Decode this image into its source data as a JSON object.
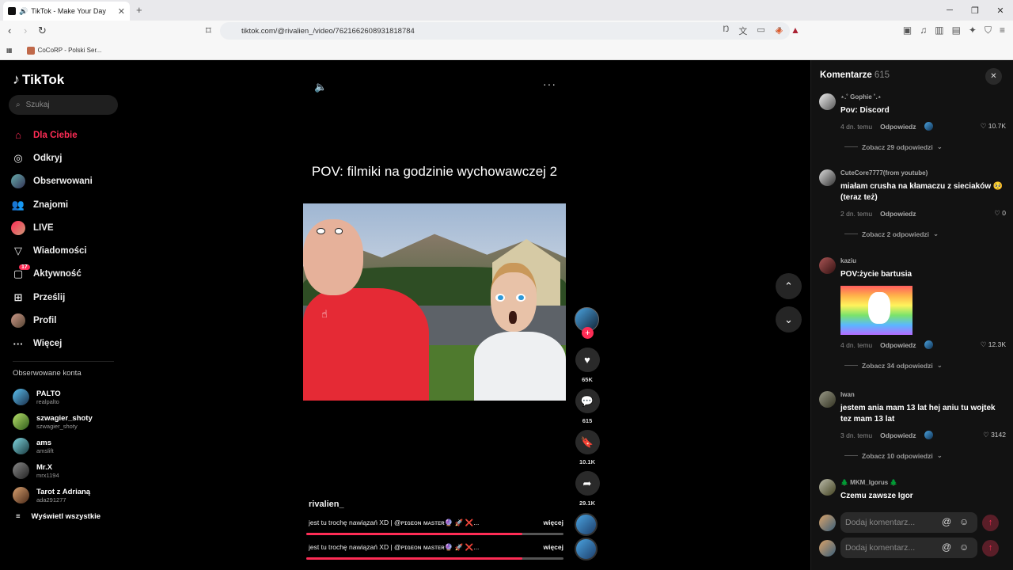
{
  "browser": {
    "tab_title": "TikTok - Make Your Day",
    "url": "tiktok.com/@rivalien_/video/7621662608931818784",
    "bookmark": "CoCoRP - Polski Ser..."
  },
  "sidebar": {
    "logo": "TikTok",
    "search_placeholder": "Szukaj",
    "nav": [
      {
        "label": "Dla Ciebie"
      },
      {
        "label": "Odkryj"
      },
      {
        "label": "Obserwowani"
      },
      {
        "label": "Znajomi"
      },
      {
        "label": "LIVE"
      },
      {
        "label": "Wiadomości"
      },
      {
        "label": "Aktywność",
        "badge": "17"
      },
      {
        "label": "Prześlij"
      },
      {
        "label": "Profil"
      },
      {
        "label": "Więcej"
      }
    ],
    "followed_title": "Obserwowane konta",
    "followed": [
      {
        "name": "PALTO",
        "handle": "realpalto"
      },
      {
        "name": "szwagier_shoty",
        "handle": "szwagier_shoty"
      },
      {
        "name": "ams",
        "handle": "amslift"
      },
      {
        "name": "Mr.X",
        "handle": "mrx1194"
      },
      {
        "name": "Tarot z Adrianą",
        "handle": "ada291277"
      }
    ],
    "show_all": "Wyświetl wszystkie"
  },
  "video": {
    "caption": "POV: filmiki na godzinie wychowawczej 2",
    "username": "rivalien_",
    "description": "jest tu trochę nawiązań XD | @ᴘɪɢᴇᴏɴ ᴍᴀsᴛᴇʀ🔮 🚀 ❌...",
    "more_label": "więcej",
    "progress": 0.84
  },
  "actions": {
    "likes": "65K",
    "comments": "615",
    "saves": "10.1K",
    "shares": "29.1K"
  },
  "comments": {
    "title": "Komentarze",
    "count": "615",
    "items": [
      {
        "author": "⋆.˚ Gophie ˚.⋆",
        "text": "Pov: Discord",
        "date": "4 dn. temu",
        "reply": "Odpowiedz",
        "likes": "10.7K",
        "replies": "Zobacz 29 odpowiedzi"
      },
      {
        "author": "CuteCore7777(from youtube)",
        "text": "miałam crusha na kłamaczu z sieciaków 🥺 (teraz też)",
        "date": "2 dn. temu",
        "reply": "Odpowiedz",
        "likes": "0",
        "replies": "Zobacz 2 odpowiedzi"
      },
      {
        "author": "kaziu",
        "text": "POV:życie bartusia",
        "date": "4 dn. temu",
        "reply": "Odpowiedz",
        "likes": "12.3K",
        "replies": "Zobacz 34 odpowiedzi"
      },
      {
        "author": "Iwan",
        "text": "jestem ania mam 13 lat hej aniu tu wojtek tez mam 13 lat",
        "date": "3 dn. temu",
        "reply": "Odpowiedz",
        "likes": "3142",
        "replies": "Zobacz 10 odpowiedzi"
      },
      {
        "author": "🌲 MKM_Igorus 🌲",
        "text": "Czemu zawsze Igor"
      }
    ],
    "input_placeholder": "Dodaj komentarz..."
  }
}
